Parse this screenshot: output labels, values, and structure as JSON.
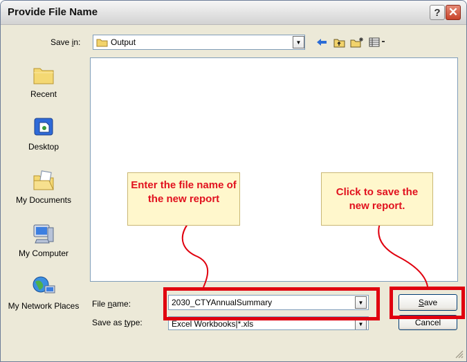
{
  "dialog": {
    "title": "Provide File Name",
    "help_glyph": "?",
    "close_glyph": "✕"
  },
  "save_in": {
    "label_pre": "Save ",
    "label_key": "i",
    "label_post": "n:",
    "value": "Output"
  },
  "places": [
    {
      "label": "Recent",
      "icon": "recent-folder-icon"
    },
    {
      "label": "Desktop",
      "icon": "desktop-icon"
    },
    {
      "label": "My Documents",
      "icon": "my-documents-icon"
    },
    {
      "label": "My Computer",
      "icon": "my-computer-icon"
    },
    {
      "label": "My Network Places",
      "icon": "network-places-icon"
    }
  ],
  "file_name": {
    "label_pre": "File ",
    "label_key": "n",
    "label_post": "ame:",
    "value": "2030_CTYAnnualSummary"
  },
  "save_as_type": {
    "label_pre": "Save as ",
    "label_key": "t",
    "label_post": "ype:",
    "value": "Excel Workbooks|*.xls"
  },
  "buttons": {
    "save_key": "S",
    "save_rest": "ave",
    "cancel": "Cancel"
  },
  "callouts": {
    "file_name": "Enter the file name of the new report",
    "save": "Click to save the new report."
  },
  "colors": {
    "highlight": "#e0000e",
    "callout_text": "#e1111e",
    "callout_bg": "#fff7cc"
  }
}
